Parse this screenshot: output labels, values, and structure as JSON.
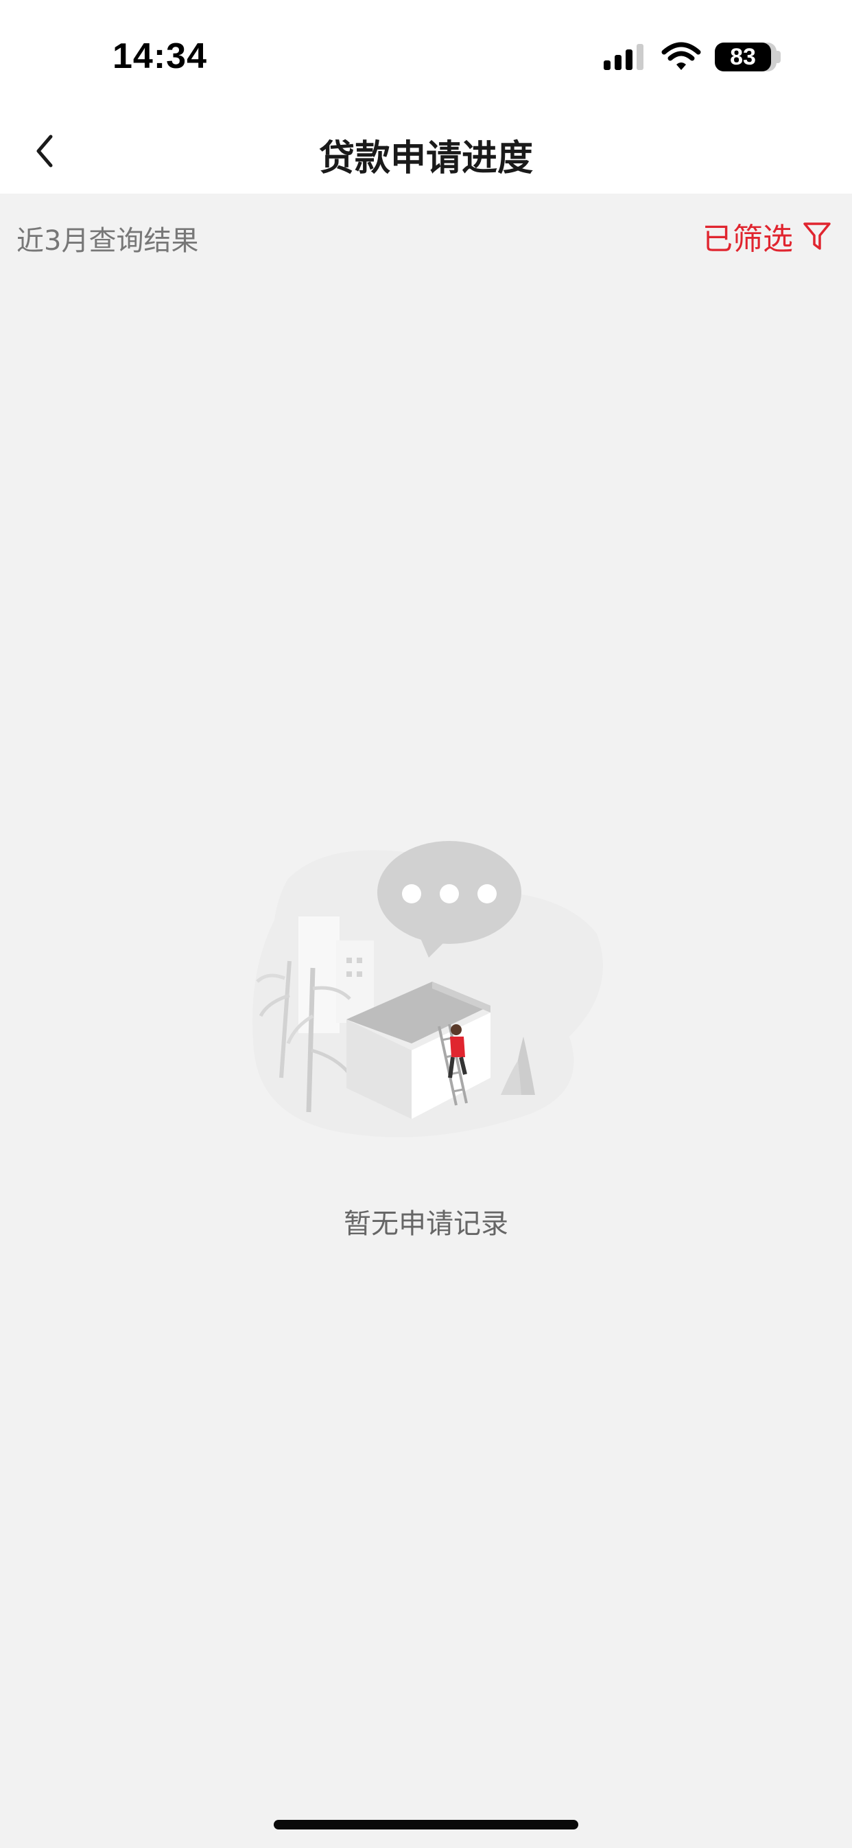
{
  "status_bar": {
    "time": "14:34",
    "battery": "83",
    "signal_icon": "cellular-signal-icon",
    "wifi_icon": "wifi-icon"
  },
  "nav": {
    "title": "贷款申请进度",
    "back_icon": "chevron-left-icon"
  },
  "filter_bar": {
    "summary": "近3月查询结果",
    "filter_label": "已筛选",
    "filter_icon": "funnel-icon"
  },
  "empty_state": {
    "message": "暂无申请记录",
    "illustration": "empty-records-illustration"
  },
  "colors": {
    "accent": "#e0252f",
    "background": "#f2f2f2",
    "nav_background": "#ffffff",
    "muted_text": "#777777"
  }
}
